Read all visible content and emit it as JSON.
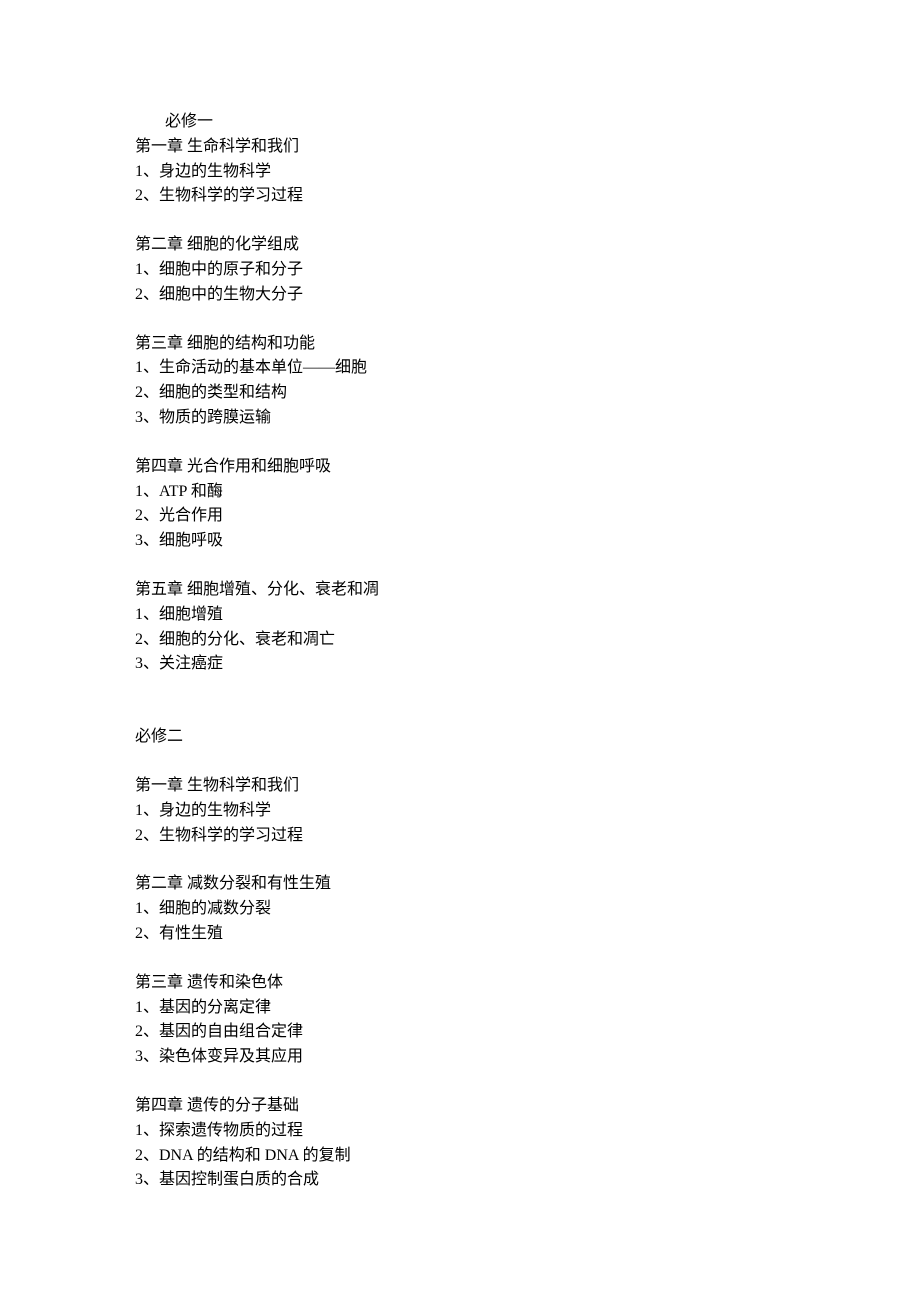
{
  "books": [
    {
      "title": "必修一",
      "title_indented": true,
      "chapters": [
        {
          "title": "第一章 生命科学和我们",
          "items": [
            "1、身边的生物科学",
            "2、生物科学的学习过程"
          ]
        },
        {
          "title": "第二章 细胞的化学组成",
          "items": [
            "1、细胞中的原子和分子",
            "2、细胞中的生物大分子"
          ]
        },
        {
          "title": "第三章 细胞的结构和功能",
          "items": [
            "1、生命活动的基本单位——细胞",
            "2、细胞的类型和结构",
            "3、物质的跨膜运输"
          ]
        },
        {
          "title": "第四章 光合作用和细胞呼吸",
          "items": [
            "1、ATP 和酶",
            "2、光合作用",
            "3、细胞呼吸"
          ]
        },
        {
          "title": "第五章 细胞增殖、分化、衰老和凋",
          "items": [
            "1、细胞增殖",
            "2、细胞的分化、衰老和凋亡",
            "3、关注癌症"
          ]
        }
      ]
    },
    {
      "title": "必修二",
      "title_indented": false,
      "chapters": [
        {
          "title": "第一章 生物科学和我们",
          "items": [
            "1、身边的生物科学",
            "2、生物科学的学习过程"
          ]
        },
        {
          "title": "第二章 减数分裂和有性生殖",
          "items": [
            "1、细胞的减数分裂",
            "2、有性生殖"
          ]
        },
        {
          "title": "第三章 遗传和染色体",
          "items": [
            "1、基因的分离定律",
            "2、基因的自由组合定律",
            "3、染色体变异及其应用"
          ]
        },
        {
          "title": "第四章 遗传的分子基础",
          "items": [
            "1、探索遗传物质的过程",
            "2、DNA 的结构和 DNA 的复制",
            "3、基因控制蛋白质的合成"
          ]
        }
      ]
    }
  ]
}
